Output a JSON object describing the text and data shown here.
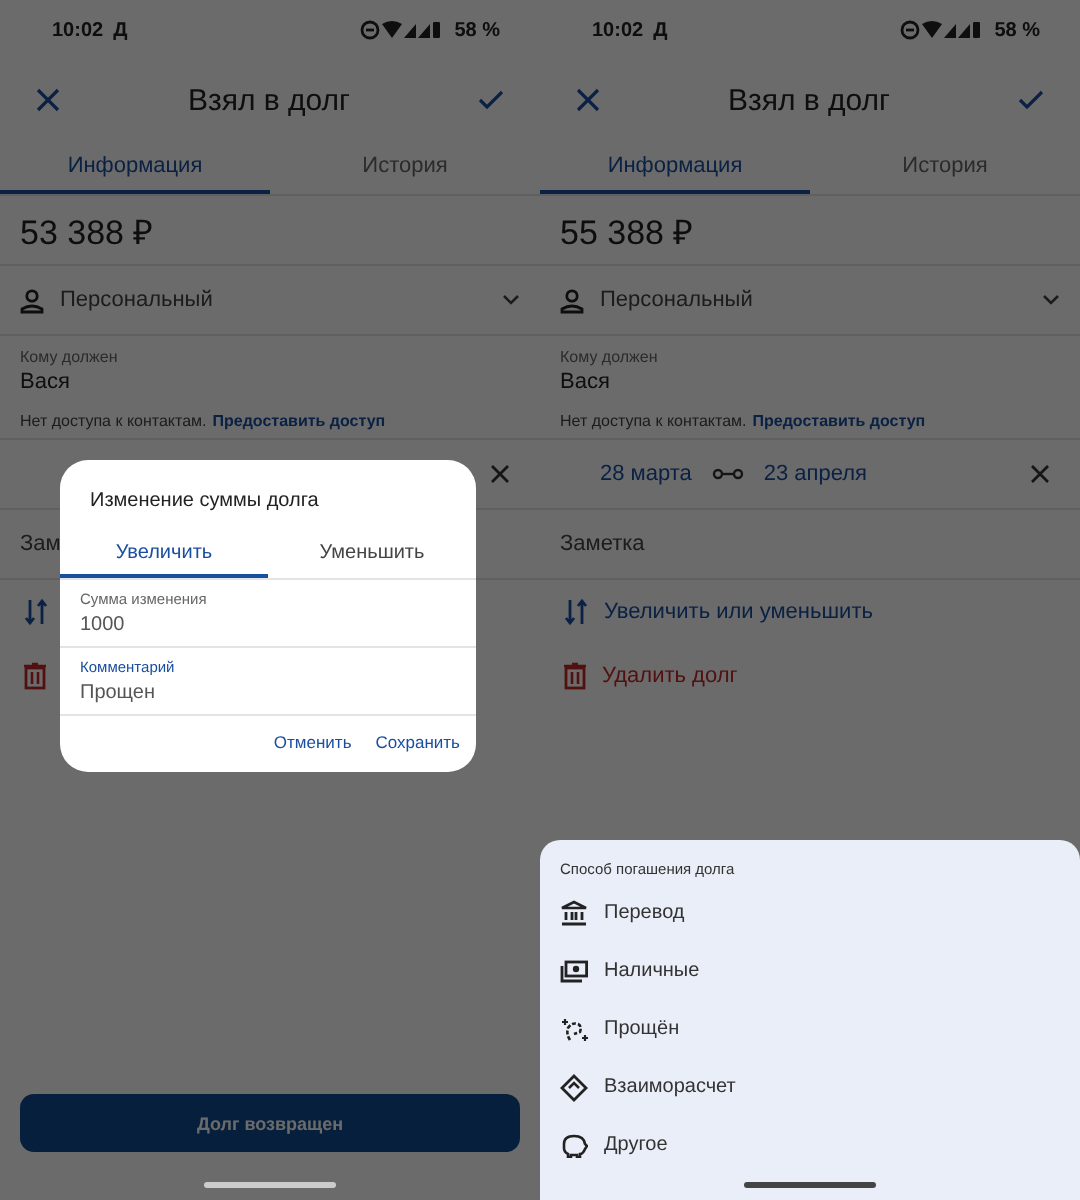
{
  "screens": [
    {
      "status_bar": {
        "time": "10:02",
        "carrier": "Д",
        "battery": "58 %"
      },
      "toolbar": {
        "title": "Взял в долг"
      },
      "tabs": [
        {
          "label": "Информация",
          "selected": true
        },
        {
          "label": "История",
          "selected": false
        }
      ],
      "amount": "53 388 ₽",
      "category": "Персональный",
      "creditor": {
        "label": "Кому должен",
        "value": "Вася"
      },
      "contacts_note": {
        "text": "Нет доступа к контактам.",
        "link": "Предоставить доступ"
      },
      "note": "Зам",
      "actions": [
        {
          "kind": "adjust"
        },
        {
          "kind": "delete"
        }
      ],
      "primary_button": "Долг возвращен",
      "dialog": {
        "title": "Изменение суммы долга",
        "tabs": [
          {
            "label": "Увеличить",
            "selected": true
          },
          {
            "label": "Уменьшить",
            "selected": false
          }
        ],
        "fields": [
          {
            "label": "Сумма изменения",
            "value": "1000",
            "focused": false
          },
          {
            "label": "Комментарий",
            "value": "Прощен",
            "focused": true
          }
        ],
        "buttons": [
          "Отменить",
          "Сохранить"
        ]
      }
    },
    {
      "status_bar": {
        "time": "10:02",
        "carrier": "Д",
        "battery": "58 %"
      },
      "toolbar": {
        "title": "Взял в долг"
      },
      "tabs": [
        {
          "label": "Информация",
          "selected": true
        },
        {
          "label": "История",
          "selected": false
        }
      ],
      "amount": "55 388 ₽",
      "category": "Персональный",
      "creditor": {
        "label": "Кому должен",
        "value": "Вася"
      },
      "contacts_note": {
        "text": "Нет доступа к контактам.",
        "link": "Предоставить доступ"
      },
      "dates": {
        "start": "28 марта",
        "end": "23 апреля"
      },
      "note": "Заметка",
      "actions": [
        {
          "kind": "adjust",
          "label": "Увеличить или уменьшить"
        },
        {
          "kind": "delete",
          "label": "Удалить долг"
        }
      ],
      "sheet": {
        "title": "Способ погашения долга",
        "items": [
          {
            "kind": "transfer",
            "label": "Перевод"
          },
          {
            "kind": "cash",
            "label": "Наличные"
          },
          {
            "kind": "forgiven",
            "label": "Прощён"
          },
          {
            "kind": "offset",
            "label": "Взаиморасчет"
          },
          {
            "kind": "other",
            "label": "Другое"
          }
        ]
      }
    }
  ]
}
